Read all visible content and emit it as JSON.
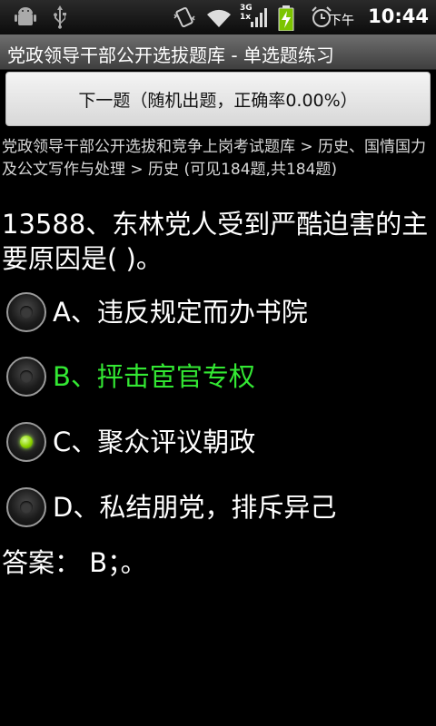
{
  "status_bar": {
    "icons": [
      "android-debug-icon",
      "usb-icon",
      "vibrate-icon",
      "wifi-icon",
      "signal-3g-icon",
      "battery-charging-icon",
      "alarm-icon"
    ],
    "network_label_top": "3G",
    "network_label_bottom": "1x",
    "ampm": "下午",
    "time": "10:44"
  },
  "titlebar": {
    "title": "党政领导干部公开选拔题库 - 单选题练习"
  },
  "next_button": {
    "label": "下一题（随机出题，正确率0.00%）"
  },
  "breadcrumb": "党政领导干部公开选拔和竞争上岗考试题库 > 历史、国情国力及公文写作与处理 > 历史 (可见184题,共184题)",
  "question": "13588、东林党人受到严酷迫害的主要原因是(  )。",
  "options": [
    {
      "label": "A、违反规定而办书院",
      "checked": false,
      "correct": false
    },
    {
      "label": "B、抨击宦官专权",
      "checked": false,
      "correct": true
    },
    {
      "label": "C、聚众评议朝政",
      "checked": true,
      "correct": false
    },
    {
      "label": "D、私结朋党，排斥异己",
      "checked": false,
      "correct": false
    }
  ],
  "answer": "答案： B；。",
  "colors": {
    "correct_text": "#33e833",
    "checked_radio": "#8fd400",
    "background": "#000000"
  }
}
